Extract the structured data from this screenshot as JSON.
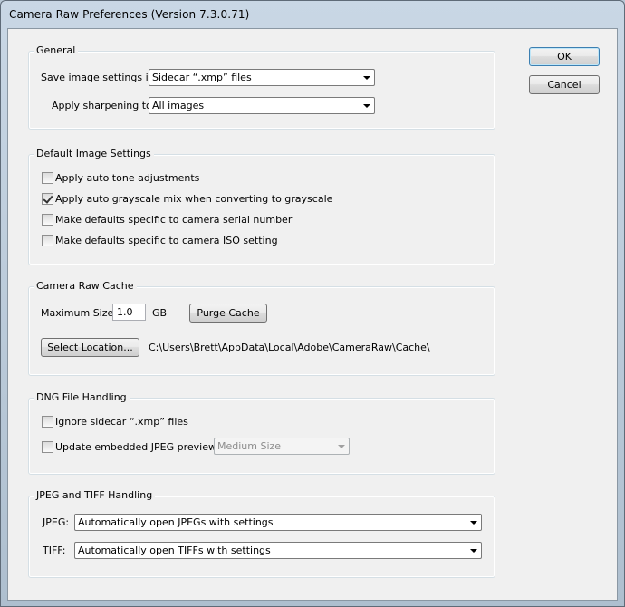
{
  "window": {
    "title": "Camera Raw Preferences  (Version 7.3.0.71)"
  },
  "buttons": {
    "ok": "OK",
    "cancel": "Cancel"
  },
  "general": {
    "label": "General",
    "save_label": "Save image settings in:",
    "save_value": "Sidecar “.xmp” files",
    "sharpen_label": "Apply sharpening to:",
    "sharpen_value": "All images"
  },
  "defaults": {
    "label": "Default Image Settings",
    "items": [
      {
        "label": "Apply auto tone adjustments",
        "checked": false
      },
      {
        "label": "Apply auto grayscale mix when converting to grayscale",
        "checked": true
      },
      {
        "label": "Make defaults specific to camera serial number",
        "checked": false
      },
      {
        "label": "Make defaults specific to camera ISO setting",
        "checked": false
      }
    ]
  },
  "cache": {
    "label": "Camera Raw Cache",
    "max_label": "Maximum Size:",
    "max_value": "1.0",
    "unit": "GB",
    "purge": "Purge Cache",
    "select_location": "Select Location...",
    "path": "C:\\Users\\Brett\\AppData\\Local\\Adobe\\CameraRaw\\Cache\\"
  },
  "dng": {
    "label": "DNG File Handling",
    "ignore_label": "Ignore sidecar “.xmp” files",
    "ignore_checked": false,
    "update_label": "Update embedded JPEG previews:",
    "update_checked": false,
    "preview_value": "Medium Size"
  },
  "jpeg_tiff": {
    "label": "JPEG and TIFF Handling",
    "jpeg_label": "JPEG:",
    "jpeg_value": "Automatically open JPEGs with settings",
    "tiff_label": "TIFF:",
    "tiff_value": "Automatically open TIFFs with settings"
  }
}
